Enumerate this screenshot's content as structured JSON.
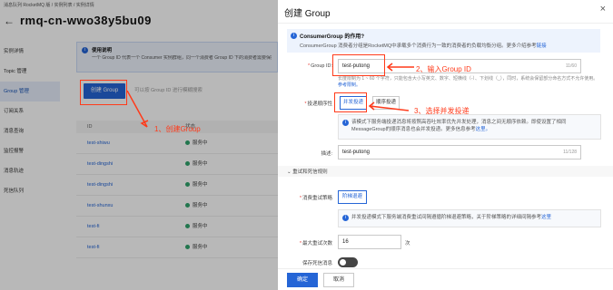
{
  "left_page": {
    "breadcrumb": "消息队列 RocketMQ 版 / 实例列表 / 实例详情",
    "title": "rmq-cn-wwo38y5bu09",
    "nav": [
      "实例详情",
      "Topic 管理",
      "Group 管理",
      "订阅关系",
      "消息查询",
      "监控报警",
      "消息轨迹",
      "死信队列"
    ],
    "nav_active_index": 2,
    "info_title": "使用说明",
    "info_body": "一个 Group ID 代表一个 Consumer 实例群组，同一个消费者 Group ID 下的消费者需要保持订阅关系一致，具体请参见这里。",
    "create_button": "创建 Group",
    "search_placeholder": "可以按 Group ID 进行模糊搜索",
    "table": {
      "columns": [
        "ID",
        "状态"
      ],
      "rows": [
        {
          "id": "test-shiwu",
          "status": "服务中"
        },
        {
          "id": "test-dingshi",
          "status": "服务中"
        },
        {
          "id": "test-dingshi",
          "status": "服务中"
        },
        {
          "id": "test-shunxu",
          "status": "服务中"
        },
        {
          "id": "test-fi",
          "status": "服务中"
        },
        {
          "id": "test-fi",
          "status": "服务中"
        }
      ]
    }
  },
  "annotations": {
    "step1": "1、创建Group",
    "step2": "2、输入Group ID",
    "step3": "3、选择并发投递"
  },
  "drawer": {
    "title": "创建 Group",
    "close_icon": "×",
    "info": {
      "title": "ConsumerGroup 的作用?",
      "body": "ConsumerGroup 消费者分组是RocketMQ中承载多个消费行为一致的消费者的负载均衡分组。更多介绍参考",
      "link": "链接"
    },
    "group_id": {
      "label": "Group ID:",
      "value": "test-putong",
      "count": "11/60",
      "hint": "长度限制为 1 ~ 60 个字符，只能包含大小写英文、数字、短横线（-）、下划线（_），同时，系统会保留部分命名方式不允许使用。",
      "hint_link": "参考限制。"
    },
    "delivery": {
      "label": "投递顺序性",
      "options": [
        "并发投递",
        "顺序投递"
      ],
      "selected": 0,
      "note": "该模式下服务端投递消息将按照高吞吐效率优先并发处理，消息之间无顺序依赖。即使设置了相同MessageGroup的顺序消息也会并发投递。更多信息参考",
      "note_link": "这里。"
    },
    "description": {
      "label": "描述:",
      "value": "test-putong",
      "count": "11/128"
    },
    "retry_section": "重试和死信规则",
    "retry_policy": {
      "label": "消费重试策略",
      "option": "阶梯退避",
      "note": "并发投递模式下服务端消费重试间隔遵循阶梯退避策略，关于阶梯策略的详细间隔参考",
      "note_link": "这里"
    },
    "max_retry": {
      "label": "最大重试次数",
      "value": "16",
      "unit": "次"
    },
    "dead_letter": {
      "label": "保存死信消息"
    },
    "ok": "确定",
    "cancel": "取消"
  },
  "colors": {
    "primary": "#2565d6",
    "annotation": "#ff3a1a",
    "info_bg": "#edf3fd"
  }
}
